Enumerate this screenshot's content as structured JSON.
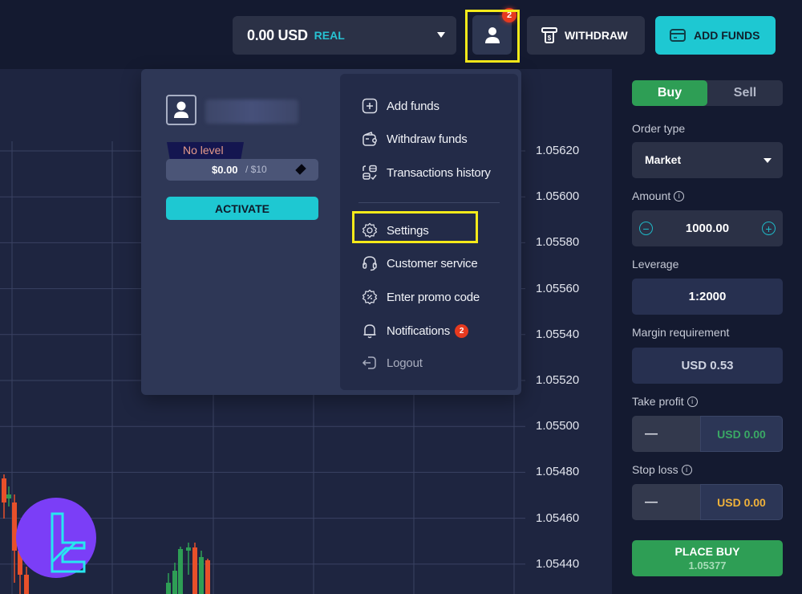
{
  "topbar": {
    "balance_amount": "0.00 USD",
    "account_type": "REAL",
    "profile_badge_count": "2",
    "withdraw_label": "WITHDRAW",
    "add_funds_label": "ADD FUNDS"
  },
  "colors": {
    "accent_cyan": "#1ec8d2",
    "buy_green": "#2e9e55",
    "sell_red": "#e8502a",
    "highlight_yellow": "#f5ea1a",
    "badge_red": "#e63a1f"
  },
  "chart": {
    "price_labels": [
      "1.05620",
      "1.05600",
      "1.05580",
      "1.05560",
      "1.05540",
      "1.05520",
      "1.05500",
      "1.05480",
      "1.05460",
      "1.05440"
    ]
  },
  "profile_menu": {
    "level": "No level",
    "progress_current": "$0.00",
    "progress_target": "/ $10",
    "progress_fraction": 0,
    "activate_label": "ACTIVATE",
    "items": [
      {
        "label": "Add funds",
        "icon": "plus-square-icon"
      },
      {
        "label": "Withdraw funds",
        "icon": "wallet-icon"
      },
      {
        "label": "Transactions history",
        "icon": "transactions-icon"
      },
      {
        "label": "Settings",
        "icon": "gear-icon"
      },
      {
        "label": "Customer service",
        "icon": "headset-icon"
      },
      {
        "label": "Enter promo code",
        "icon": "promo-badge-icon"
      },
      {
        "label": "Notifications",
        "icon": "bell-icon",
        "badge": "2"
      },
      {
        "label": "Logout",
        "icon": "logout-icon"
      }
    ]
  },
  "order_panel": {
    "buy_label": "Buy",
    "sell_label": "Sell",
    "order_type_label": "Order type",
    "order_type_value": "Market",
    "amount_label": "Amount",
    "amount_value": "1000.00",
    "leverage_label": "Leverage",
    "leverage_value": "1:2000",
    "margin_label": "Margin requirement",
    "margin_value": "USD 0.53",
    "take_profit_label": "Take profit",
    "take_profit_toggle": "—",
    "take_profit_value": "USD 0.00",
    "stop_loss_label": "Stop loss",
    "stop_loss_toggle": "—",
    "stop_loss_value": "USD 0.00",
    "place_label": "PLACE BUY",
    "place_price": "1.05377"
  }
}
